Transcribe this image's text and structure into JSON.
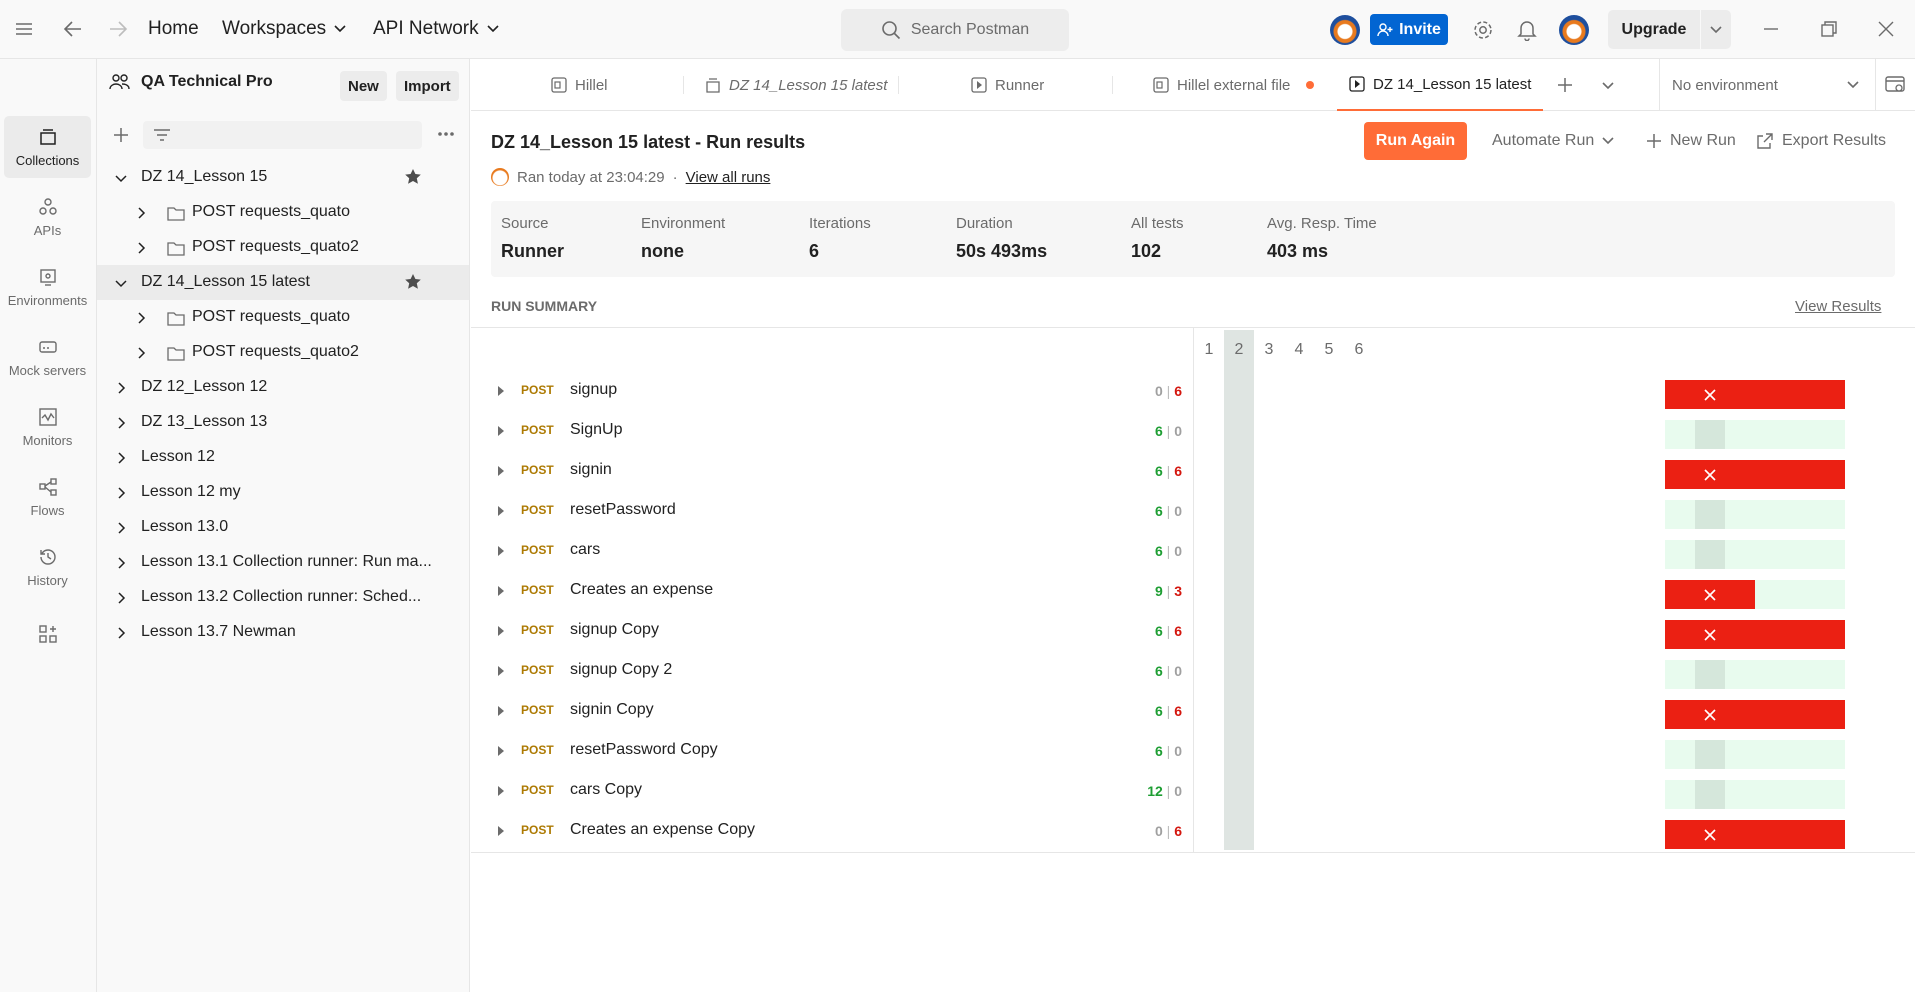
{
  "topbar": {
    "home": "Home",
    "workspaces": "Workspaces",
    "api_network": "API Network",
    "search_placeholder": "Search Postman",
    "invite": "Invite",
    "upgrade": "Upgrade"
  },
  "rail": [
    {
      "label": "Collections",
      "icon": "collections-icon",
      "active": true
    },
    {
      "label": "APIs",
      "icon": "apis-icon"
    },
    {
      "label": "Environments",
      "icon": "environments-icon"
    },
    {
      "label": "Mock servers",
      "icon": "mock-servers-icon"
    },
    {
      "label": "Monitors",
      "icon": "monitors-icon"
    },
    {
      "label": "Flows",
      "icon": "flows-icon"
    },
    {
      "label": "History",
      "icon": "history-icon"
    }
  ],
  "sidebar": {
    "workspace_name": "QA Technical Pro",
    "new_label": "New",
    "import_label": "Import",
    "tree": [
      {
        "label": "DZ 14_Lesson 15",
        "level": 0,
        "expanded": true,
        "star": true
      },
      {
        "label": "POST requests_quato",
        "level": 1,
        "folder": true
      },
      {
        "label": "POST requests_quato2",
        "level": 1,
        "folder": true
      },
      {
        "label": "DZ 14_Lesson 15 latest",
        "level": 0,
        "expanded": true,
        "star": true,
        "selected": true
      },
      {
        "label": "POST requests_quato",
        "level": 1,
        "folder": true
      },
      {
        "label": "POST requests_quato2",
        "level": 1,
        "folder": true
      },
      {
        "label": "DZ 12_Lesson 12",
        "level": 0
      },
      {
        "label": "DZ 13_Lesson 13",
        "level": 0
      },
      {
        "label": "Lesson 12",
        "level": 0
      },
      {
        "label": "Lesson 12 my",
        "level": 0
      },
      {
        "label": "Lesson 13.0",
        "level": 0
      },
      {
        "label": "Lesson 13.1 Collection runner: Run ma...",
        "level": 0
      },
      {
        "label": "Lesson 13.2 Collection runner: Sched...",
        "level": 0
      },
      {
        "label": "Lesson 13.7 Newman",
        "level": 0
      }
    ]
  },
  "tabs": [
    {
      "label": "Hillel",
      "icon": "request-tab-icon"
    },
    {
      "label": "DZ 14_Lesson 15 latest",
      "icon": "collection-tab-icon",
      "italic": true
    },
    {
      "label": "Runner",
      "icon": "runner-tab-icon"
    },
    {
      "label": "Hillel external file",
      "icon": "request-tab-icon",
      "unsaved": true
    },
    {
      "label": "DZ 14_Lesson 15 latest",
      "icon": "runner-tab-icon",
      "active": true
    }
  ],
  "environment": "No environment",
  "run": {
    "title": "DZ 14_Lesson 15 latest - Run results",
    "ran_text": "Ran today at 23:04:29",
    "view_all_runs": "View all runs",
    "run_again": "Run Again",
    "automate_run": "Automate Run",
    "new_run": "New Run",
    "export_results": "Export Results",
    "stats": [
      {
        "label": "Source",
        "value": "Runner"
      },
      {
        "label": "Environment",
        "value": "none"
      },
      {
        "label": "Iterations",
        "value": "6"
      },
      {
        "label": "Duration",
        "value": "50s 493ms"
      },
      {
        "label": "All tests",
        "value": "102"
      },
      {
        "label": "Avg. Resp. Time",
        "value": "403 ms"
      }
    ],
    "summary_label": "RUN SUMMARY",
    "view_results": "View Results",
    "iterations": [
      "1",
      "2",
      "3",
      "4",
      "5",
      "6"
    ],
    "selected_iteration": 2,
    "requests": [
      {
        "method": "POST",
        "name": "signup",
        "passed": "0",
        "failed": "6",
        "failed_iterations": 6
      },
      {
        "method": "POST",
        "name": "SignUp",
        "passed": "6",
        "failed": "0",
        "failed_iterations": 0
      },
      {
        "method": "POST",
        "name": "signin",
        "passed": "6",
        "failed": "6",
        "failed_iterations": 6
      },
      {
        "method": "POST",
        "name": "resetPassword",
        "passed": "6",
        "failed": "0",
        "failed_iterations": 0
      },
      {
        "method": "POST",
        "name": "cars",
        "passed": "6",
        "failed": "0",
        "failed_iterations": 0
      },
      {
        "method": "POST",
        "name": "Creates an expense",
        "passed": "9",
        "failed": "3",
        "failed_iterations": 3
      },
      {
        "method": "POST",
        "name": "signup Copy",
        "passed": "6",
        "failed": "6",
        "failed_iterations": 6
      },
      {
        "method": "POST",
        "name": "signup Copy 2",
        "passed": "6",
        "failed": "0",
        "failed_iterations": 0
      },
      {
        "method": "POST",
        "name": "signin Copy",
        "passed": "6",
        "failed": "6",
        "failed_iterations": 6
      },
      {
        "method": "POST",
        "name": "resetPassword Copy",
        "passed": "6",
        "failed": "0",
        "failed_iterations": 0
      },
      {
        "method": "POST",
        "name": "cars Copy",
        "passed": "12",
        "failed": "0",
        "failed_iterations": 0
      },
      {
        "method": "POST",
        "name": "Creates an expense Copy",
        "passed": "0",
        "failed": "6",
        "failed_iterations": 6
      }
    ]
  },
  "colors": {
    "accent": "#ff6c37",
    "invite": "#0265d2",
    "pass": "#1e9e33",
    "fail": "#d4160e",
    "fail_bar": "#eb2013",
    "method_post": "#ad7a03"
  }
}
